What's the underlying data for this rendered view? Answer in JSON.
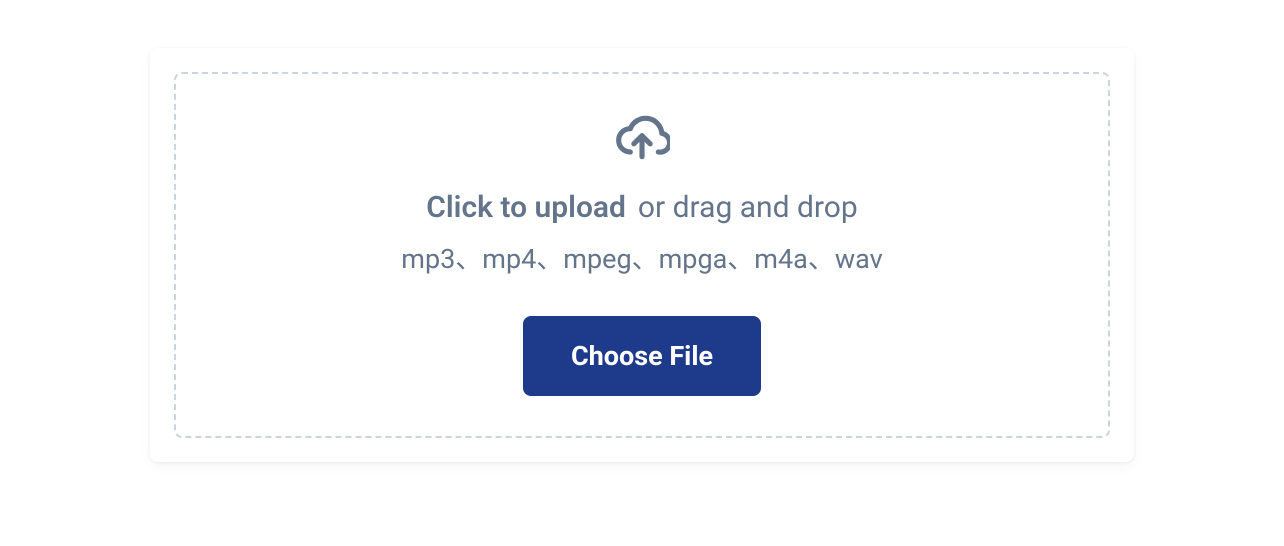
{
  "upload": {
    "click_label": "Click to upload",
    "drag_label": "or drag and drop",
    "file_types": "mp3、mp4、mpeg、mpga、m4a、wav",
    "choose_button": "Choose File"
  }
}
